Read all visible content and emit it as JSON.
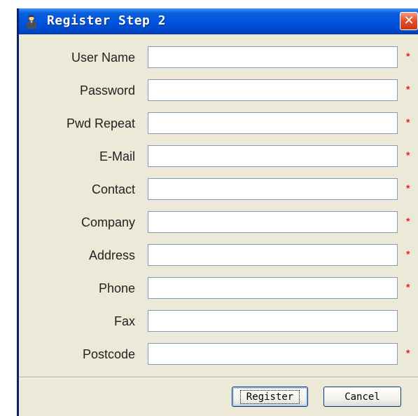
{
  "window": {
    "title": "Register Step 2",
    "close_glyph": "✕",
    "icon": "user-icon",
    "titlebar_color": "#0054e3",
    "required_color": "#e1251b"
  },
  "form": {
    "required_mark": "*",
    "fields": [
      {
        "label": "User Name",
        "value": "",
        "required": true
      },
      {
        "label": "Password",
        "value": "",
        "required": true
      },
      {
        "label": "Pwd Repeat",
        "value": "",
        "required": true
      },
      {
        "label": "E-Mail",
        "value": "",
        "required": true
      },
      {
        "label": "Contact",
        "value": "",
        "required": true
      },
      {
        "label": "Company",
        "value": "",
        "required": true
      },
      {
        "label": "Address",
        "value": "",
        "required": true
      },
      {
        "label": "Phone",
        "value": "",
        "required": true
      },
      {
        "label": "Fax",
        "value": "",
        "required": false
      },
      {
        "label": "Postcode",
        "value": "",
        "required": true
      }
    ]
  },
  "buttons": {
    "register": "Register",
    "cancel": "Cancel"
  }
}
